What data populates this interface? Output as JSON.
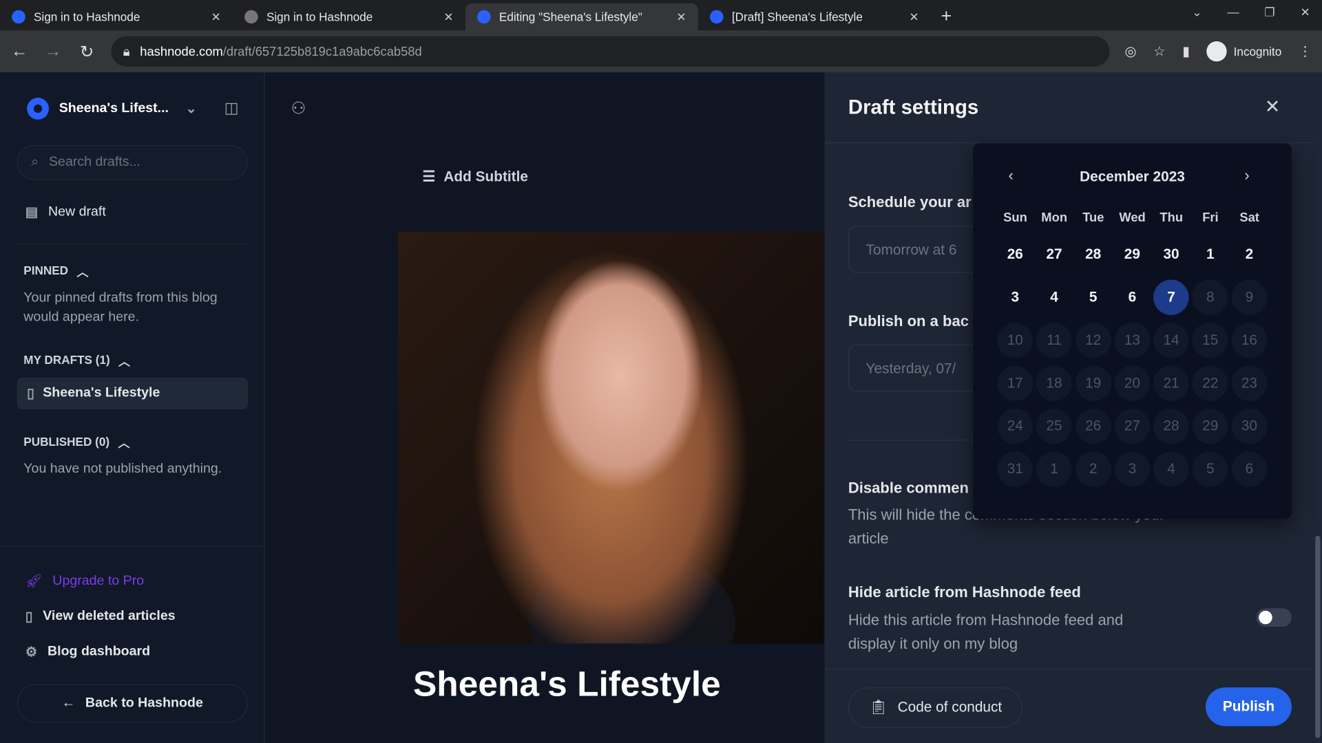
{
  "browser": {
    "tabs": [
      {
        "title": "Sign in to Hashnode",
        "active": false,
        "icon": "hashnode-icon"
      },
      {
        "title": "Sign in to Hashnode",
        "active": false,
        "icon": "loading-globe-icon"
      },
      {
        "title": "Editing \"Sheena's Lifestyle\"",
        "active": true,
        "icon": "hashnode-icon"
      },
      {
        "title": "[Draft] Sheena's Lifestyle",
        "active": false,
        "icon": "hashnode-icon"
      }
    ],
    "url_host": "hashnode.com",
    "url_path": "/draft/657125b819c1a9abc6cab58d",
    "profile": "Incognito"
  },
  "sidebar": {
    "blog_name": "Sheena's Lifest...",
    "search_placeholder": "Search drafts...",
    "new_draft": "New draft",
    "pinned_label": "PINNED",
    "pinned_empty": "Your pinned drafts from this blog would appear here.",
    "drafts_label": "MY DRAFTS (1)",
    "drafts": [
      "Sheena's Lifestyle"
    ],
    "published_label": "PUBLISHED (0)",
    "published_empty": "You have not published anything.",
    "upgrade": "Upgrade to Pro",
    "deleted": "View deleted articles",
    "dashboard": "Blog dashboard",
    "back": "Back to Hashnode",
    "accent": "#7c3aed"
  },
  "editor": {
    "add_subtitle": "Add Subtitle",
    "title": "Sheena's Lifestyle"
  },
  "panel": {
    "title": "Draft settings",
    "schedule_label": "Schedule your ar",
    "schedule_value": "Tomorrow at 6",
    "backdate_label": "Publish on a bac",
    "backdate_value": "Yesterday, 07/",
    "comments_label": "Disable commen",
    "comments_desc": "This will hide the comments section below your article",
    "hide_label": "Hide article from Hashnode feed",
    "hide_desc": "Hide this article from Hashnode feed and display it only on my blog",
    "hide_on": false,
    "coc": "Code of conduct",
    "publish": "Publish",
    "accent": "#2563eb"
  },
  "calendar": {
    "month": "December 2023",
    "weekdays": [
      "Sun",
      "Mon",
      "Tue",
      "Wed",
      "Thu",
      "Fri",
      "Sat"
    ],
    "selected": "7",
    "days": [
      [
        "26",
        "e"
      ],
      [
        "27",
        "e"
      ],
      [
        "28",
        "e"
      ],
      [
        "29",
        "e"
      ],
      [
        "30",
        "e"
      ],
      [
        "1",
        "e"
      ],
      [
        "2",
        "e"
      ],
      [
        "3",
        "e"
      ],
      [
        "4",
        "e"
      ],
      [
        "5",
        "e"
      ],
      [
        "6",
        "e"
      ],
      [
        "7",
        "s"
      ],
      [
        "8",
        "d"
      ],
      [
        "9",
        "d"
      ],
      [
        "10",
        "d"
      ],
      [
        "11",
        "d"
      ],
      [
        "12",
        "d"
      ],
      [
        "13",
        "d"
      ],
      [
        "14",
        "d"
      ],
      [
        "15",
        "d"
      ],
      [
        "16",
        "d"
      ],
      [
        "17",
        "d"
      ],
      [
        "18",
        "d"
      ],
      [
        "19",
        "d"
      ],
      [
        "20",
        "d"
      ],
      [
        "21",
        "d"
      ],
      [
        "22",
        "d"
      ],
      [
        "23",
        "d"
      ],
      [
        "24",
        "d"
      ],
      [
        "25",
        "d"
      ],
      [
        "26",
        "d"
      ],
      [
        "27",
        "d"
      ],
      [
        "28",
        "d"
      ],
      [
        "29",
        "d"
      ],
      [
        "30",
        "d"
      ],
      [
        "31",
        "d"
      ],
      [
        "1",
        "d"
      ],
      [
        "2",
        "d"
      ],
      [
        "3",
        "d"
      ],
      [
        "4",
        "d"
      ],
      [
        "5",
        "d"
      ],
      [
        "6",
        "d"
      ]
    ]
  }
}
